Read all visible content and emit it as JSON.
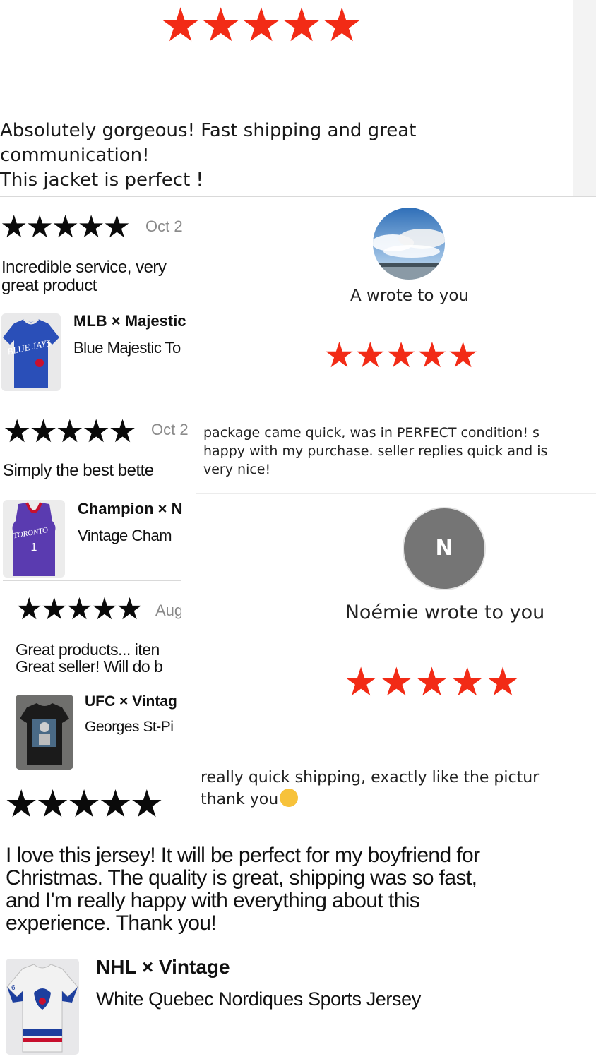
{
  "colors": {
    "star_red": "#f22b16",
    "star_black": "#0a0a0a",
    "avatar_gray": "#757575"
  },
  "top_review": {
    "rating": 5,
    "lines": [
      "Absolutely gorgeous! Fast shipping and great",
      "communication!",
      "This jacket is perfect !"
    ]
  },
  "left_reviews": [
    {
      "rating": 5,
      "date": "Oct 2",
      "lines": [
        "Incredible service, very",
        "great product"
      ],
      "brand": "MLB × Majestic",
      "item": "Blue Majestic To",
      "thumb_icon": "blue-jays-jersey-icon"
    },
    {
      "rating": 5,
      "date": "Oct 2",
      "lines": [
        "Simply the best bette"
      ],
      "brand": "Champion × N",
      "item": "Vintage Cham",
      "thumb_icon": "raptors-jersey-icon"
    },
    {
      "rating": 5,
      "date": "Aug",
      "lines": [
        "Great products... iten",
        "Great seller! Will do b"
      ],
      "brand": "UFC × Vintag",
      "item": "Georges St-Pi",
      "thumb_icon": "ufc-tshirt-icon"
    }
  ],
  "right_messages": [
    {
      "avatar_icon": "sky-photo-avatar",
      "author_line": "A wrote to you",
      "rating": 5,
      "lines": [
        "package came quick, was in PERFECT condition! s",
        "happy with my purchase. seller replies quick and is",
        "very nice!"
      ]
    },
    {
      "avatar_letter": "N",
      "author_line": "Noémie wrote to you",
      "rating": 5,
      "lines": [
        "really quick shipping, exactly like the pictur",
        "thank you"
      ],
      "emoji": "😋"
    }
  ],
  "bottom_review": {
    "rating": 5,
    "lines": [
      "I love this jersey! It will be perfect for my boyfriend for",
      "Christmas. The quality is great, shipping was so fast,",
      "and I'm really happy with everything about this",
      "experience. Thank you!"
    ],
    "brand": "NHL × Vintage",
    "item": "White Quebec Nordiques Sports Jersey",
    "thumb_icon": "nordiques-jersey-icon"
  }
}
